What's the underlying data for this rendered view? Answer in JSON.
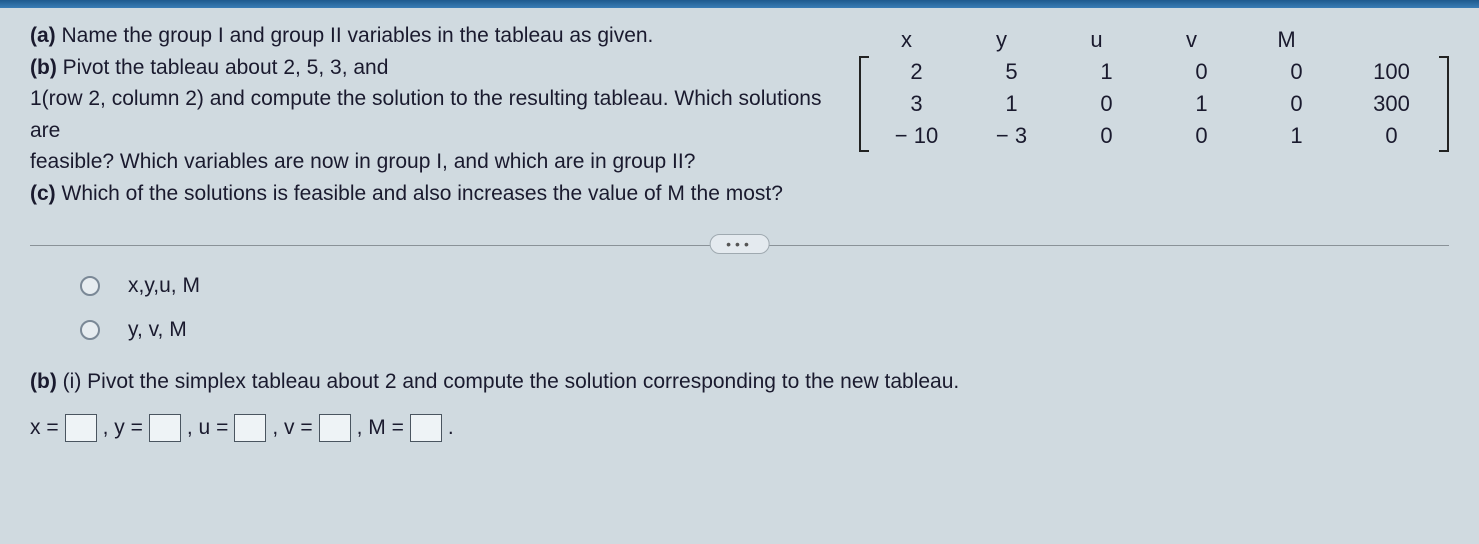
{
  "question": {
    "a_label": "(a)",
    "a_text": " Name the group I and group II variables in the tableau as given.",
    "b_label": "(b)",
    "b_text": " Pivot the tableau about 2, 5, 3, and",
    "b_text2": "1(row 2, column 2) and compute the solution to the resulting tableau. Which solutions are",
    "b_text3": "feasible? Which variables are now in group I, and which are in group II?",
    "c_label": "(c)",
    "c_text": " Which of the solutions is feasible and also increases the value of M the most?"
  },
  "tableau": {
    "headers": [
      "x",
      "y",
      "u",
      "v",
      "M",
      ""
    ],
    "rows": [
      [
        "2",
        "5",
        "1",
        "0",
        "0",
        "100"
      ],
      [
        "3",
        "1",
        "0",
        "1",
        "0",
        "300"
      ],
      [
        "− 10",
        "− 3",
        "0",
        "0",
        "1",
        "0"
      ]
    ]
  },
  "ellipsis": "•••",
  "options": {
    "opt1": "x,y,u, M",
    "opt2": "y, v, M"
  },
  "partb": {
    "label": "(b)",
    "roman": " (i) ",
    "text": "Pivot the simplex tableau about 2 and compute the solution corresponding to the new tableau."
  },
  "eq": {
    "x": "x =",
    "y": ", y =",
    "u": ", u =",
    "v": ", v =",
    "m": ", M =",
    "end": "."
  }
}
